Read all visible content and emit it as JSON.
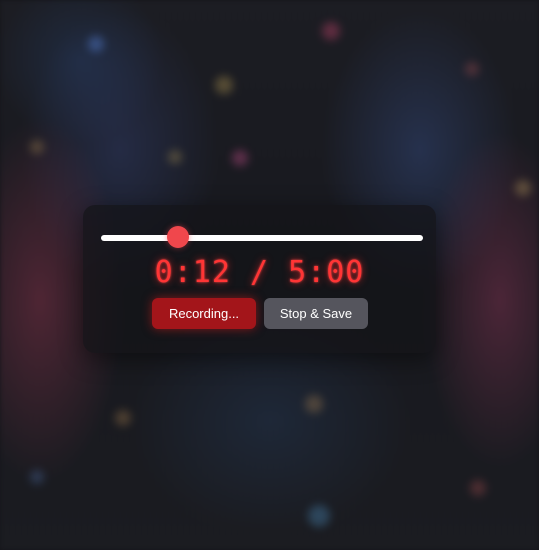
{
  "recorder": {
    "progress_fraction": 0.24,
    "elapsed": "0:12",
    "separator": "/",
    "total": "5:00",
    "record_label": "Recording...",
    "stop_label": "Stop & Save",
    "accent_color": "#f0474c",
    "record_color": "#a3151a",
    "stop_color": "#55555d"
  }
}
